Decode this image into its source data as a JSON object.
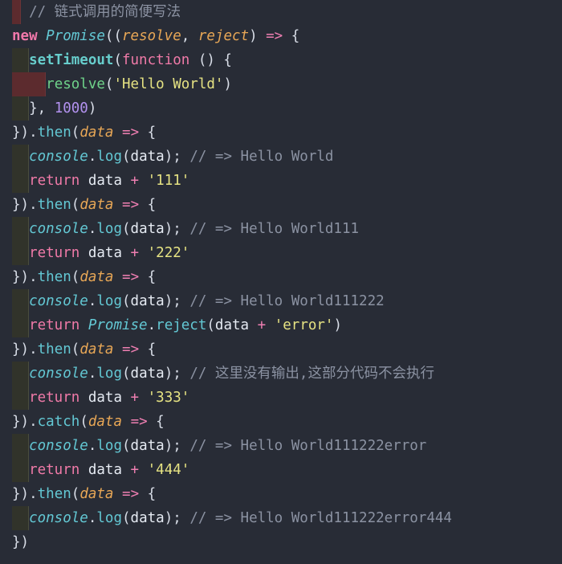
{
  "editor": {
    "language": "javascript",
    "theme_background": "#282c36",
    "font_size_px": 17.5,
    "line_height_px": 30,
    "total_lines": 23,
    "colors": {
      "background": "#282c36",
      "keyword": "#f07aa8",
      "class": "#63c8d4",
      "function": "#67cdcc",
      "parameter": "#e8a756",
      "string": "#e6e383",
      "number": "#b392f0",
      "comment": "#8b92a2",
      "punctuation": "#d9dee8",
      "indent_guide": "#31332a",
      "error_whitespace": "#5c2b2e"
    }
  },
  "code": {
    "lines": [
      {
        "n": 1,
        "indent_guides": 0,
        "error_block": {
          "start": 0,
          "cols": 1
        },
        "tokens": [
          {
            "t": "  ",
            "c": "punc"
          },
          {
            "t": "// 链式调用的简便写法",
            "c": "cmt"
          }
        ]
      },
      {
        "n": 2,
        "indent_guides": 0,
        "tokens": [
          {
            "t": "new",
            "c": "kw-b"
          },
          {
            "t": " ",
            "c": "punc"
          },
          {
            "t": "Promise",
            "c": "cls"
          },
          {
            "t": "((",
            "c": "punc"
          },
          {
            "t": "resolve",
            "c": "param"
          },
          {
            "t": ", ",
            "c": "punc"
          },
          {
            "t": "reject",
            "c": "param"
          },
          {
            "t": ") ",
            "c": "punc"
          },
          {
            "t": "=>",
            "c": "arrow"
          },
          {
            "t": " {",
            "c": "punc"
          }
        ]
      },
      {
        "n": 3,
        "indent_guides": 1,
        "tokens": [
          {
            "t": "  ",
            "c": "punc"
          },
          {
            "t": "setTimeout",
            "c": "fn"
          },
          {
            "t": "(",
            "c": "punc"
          },
          {
            "t": "function",
            "c": "kw"
          },
          {
            "t": " () {",
            "c": "punc"
          }
        ]
      },
      {
        "n": 4,
        "indent_guides": 0,
        "error_block": {
          "start": 0,
          "cols": 4
        },
        "tokens": [
          {
            "t": "    ",
            "c": "punc"
          },
          {
            "t": "resolve",
            "c": "call"
          },
          {
            "t": "(",
            "c": "punc"
          },
          {
            "t": "'Hello World'",
            "c": "str"
          },
          {
            "t": ")",
            "c": "punc"
          }
        ]
      },
      {
        "n": 5,
        "indent_guides": 1,
        "tokens": [
          {
            "t": "  }, ",
            "c": "punc"
          },
          {
            "t": "1000",
            "c": "num"
          },
          {
            "t": ")",
            "c": "punc"
          }
        ]
      },
      {
        "n": 6,
        "indent_guides": 0,
        "tokens": [
          {
            "t": "})",
            "c": "punc"
          },
          {
            "t": ".",
            "c": "punc"
          },
          {
            "t": "then",
            "c": "meth"
          },
          {
            "t": "(",
            "c": "punc"
          },
          {
            "t": "data",
            "c": "param"
          },
          {
            "t": " ",
            "c": "punc"
          },
          {
            "t": "=>",
            "c": "arrow"
          },
          {
            "t": " {",
            "c": "punc"
          }
        ]
      },
      {
        "n": 7,
        "indent_guides": 1,
        "tokens": [
          {
            "t": "  ",
            "c": "punc"
          },
          {
            "t": "console",
            "c": "cls"
          },
          {
            "t": ".",
            "c": "punc"
          },
          {
            "t": "log",
            "c": "meth"
          },
          {
            "t": "(",
            "c": "punc"
          },
          {
            "t": "data",
            "c": "ident"
          },
          {
            "t": "); ",
            "c": "punc"
          },
          {
            "t": "// => Hello World",
            "c": "cmt"
          }
        ]
      },
      {
        "n": 8,
        "indent_guides": 1,
        "tokens": [
          {
            "t": "  ",
            "c": "punc"
          },
          {
            "t": "return",
            "c": "kw"
          },
          {
            "t": " ",
            "c": "punc"
          },
          {
            "t": "data",
            "c": "ident"
          },
          {
            "t": " ",
            "c": "punc"
          },
          {
            "t": "+",
            "c": "op"
          },
          {
            "t": " ",
            "c": "punc"
          },
          {
            "t": "'111'",
            "c": "str"
          }
        ]
      },
      {
        "n": 9,
        "indent_guides": 0,
        "tokens": [
          {
            "t": "})",
            "c": "punc"
          },
          {
            "t": ".",
            "c": "punc"
          },
          {
            "t": "then",
            "c": "meth"
          },
          {
            "t": "(",
            "c": "punc"
          },
          {
            "t": "data",
            "c": "param"
          },
          {
            "t": " ",
            "c": "punc"
          },
          {
            "t": "=>",
            "c": "arrow"
          },
          {
            "t": " {",
            "c": "punc"
          }
        ]
      },
      {
        "n": 10,
        "indent_guides": 1,
        "tokens": [
          {
            "t": "  ",
            "c": "punc"
          },
          {
            "t": "console",
            "c": "cls"
          },
          {
            "t": ".",
            "c": "punc"
          },
          {
            "t": "log",
            "c": "meth"
          },
          {
            "t": "(",
            "c": "punc"
          },
          {
            "t": "data",
            "c": "ident"
          },
          {
            "t": "); ",
            "c": "punc"
          },
          {
            "t": "// => Hello World111",
            "c": "cmt"
          }
        ]
      },
      {
        "n": 11,
        "indent_guides": 1,
        "tokens": [
          {
            "t": "  ",
            "c": "punc"
          },
          {
            "t": "return",
            "c": "kw"
          },
          {
            "t": " ",
            "c": "punc"
          },
          {
            "t": "data",
            "c": "ident"
          },
          {
            "t": " ",
            "c": "punc"
          },
          {
            "t": "+",
            "c": "op"
          },
          {
            "t": " ",
            "c": "punc"
          },
          {
            "t": "'222'",
            "c": "str"
          }
        ]
      },
      {
        "n": 12,
        "indent_guides": 0,
        "tokens": [
          {
            "t": "})",
            "c": "punc"
          },
          {
            "t": ".",
            "c": "punc"
          },
          {
            "t": "then",
            "c": "meth"
          },
          {
            "t": "(",
            "c": "punc"
          },
          {
            "t": "data",
            "c": "param"
          },
          {
            "t": " ",
            "c": "punc"
          },
          {
            "t": "=>",
            "c": "arrow"
          },
          {
            "t": " {",
            "c": "punc"
          }
        ]
      },
      {
        "n": 13,
        "indent_guides": 1,
        "tokens": [
          {
            "t": "  ",
            "c": "punc"
          },
          {
            "t": "console",
            "c": "cls"
          },
          {
            "t": ".",
            "c": "punc"
          },
          {
            "t": "log",
            "c": "meth"
          },
          {
            "t": "(",
            "c": "punc"
          },
          {
            "t": "data",
            "c": "ident"
          },
          {
            "t": "); ",
            "c": "punc"
          },
          {
            "t": "// => Hello World111222",
            "c": "cmt"
          }
        ]
      },
      {
        "n": 14,
        "indent_guides": 1,
        "tokens": [
          {
            "t": "  ",
            "c": "punc"
          },
          {
            "t": "return",
            "c": "kw"
          },
          {
            "t": " ",
            "c": "punc"
          },
          {
            "t": "Promise",
            "c": "cls"
          },
          {
            "t": ".",
            "c": "punc"
          },
          {
            "t": "reject",
            "c": "meth"
          },
          {
            "t": "(",
            "c": "punc"
          },
          {
            "t": "data",
            "c": "ident"
          },
          {
            "t": " ",
            "c": "punc"
          },
          {
            "t": "+",
            "c": "op"
          },
          {
            "t": " ",
            "c": "punc"
          },
          {
            "t": "'error'",
            "c": "str"
          },
          {
            "t": ")",
            "c": "punc"
          }
        ]
      },
      {
        "n": 15,
        "indent_guides": 0,
        "tokens": [
          {
            "t": "})",
            "c": "punc"
          },
          {
            "t": ".",
            "c": "punc"
          },
          {
            "t": "then",
            "c": "meth"
          },
          {
            "t": "(",
            "c": "punc"
          },
          {
            "t": "data",
            "c": "param"
          },
          {
            "t": " ",
            "c": "punc"
          },
          {
            "t": "=>",
            "c": "arrow"
          },
          {
            "t": " {",
            "c": "punc"
          }
        ]
      },
      {
        "n": 16,
        "indent_guides": 1,
        "tokens": [
          {
            "t": "  ",
            "c": "punc"
          },
          {
            "t": "console",
            "c": "cls"
          },
          {
            "t": ".",
            "c": "punc"
          },
          {
            "t": "log",
            "c": "meth"
          },
          {
            "t": "(",
            "c": "punc"
          },
          {
            "t": "data",
            "c": "ident"
          },
          {
            "t": "); ",
            "c": "punc"
          },
          {
            "t": "// 这里没有输出,这部分代码不会执行",
            "c": "cmt"
          }
        ]
      },
      {
        "n": 17,
        "indent_guides": 1,
        "tokens": [
          {
            "t": "  ",
            "c": "punc"
          },
          {
            "t": "return",
            "c": "kw"
          },
          {
            "t": " ",
            "c": "punc"
          },
          {
            "t": "data",
            "c": "ident"
          },
          {
            "t": " ",
            "c": "punc"
          },
          {
            "t": "+",
            "c": "op"
          },
          {
            "t": " ",
            "c": "punc"
          },
          {
            "t": "'333'",
            "c": "str"
          }
        ]
      },
      {
        "n": 18,
        "indent_guides": 0,
        "tokens": [
          {
            "t": "})",
            "c": "punc"
          },
          {
            "t": ".",
            "c": "punc"
          },
          {
            "t": "catch",
            "c": "meth"
          },
          {
            "t": "(",
            "c": "punc"
          },
          {
            "t": "data",
            "c": "param"
          },
          {
            "t": " ",
            "c": "punc"
          },
          {
            "t": "=>",
            "c": "arrow"
          },
          {
            "t": " {",
            "c": "punc"
          }
        ]
      },
      {
        "n": 19,
        "indent_guides": 1,
        "tokens": [
          {
            "t": "  ",
            "c": "punc"
          },
          {
            "t": "console",
            "c": "cls"
          },
          {
            "t": ".",
            "c": "punc"
          },
          {
            "t": "log",
            "c": "meth"
          },
          {
            "t": "(",
            "c": "punc"
          },
          {
            "t": "data",
            "c": "ident"
          },
          {
            "t": "); ",
            "c": "punc"
          },
          {
            "t": "// => Hello World111222error",
            "c": "cmt"
          }
        ]
      },
      {
        "n": 20,
        "indent_guides": 1,
        "tokens": [
          {
            "t": "  ",
            "c": "punc"
          },
          {
            "t": "return",
            "c": "kw"
          },
          {
            "t": " ",
            "c": "punc"
          },
          {
            "t": "data",
            "c": "ident"
          },
          {
            "t": " ",
            "c": "punc"
          },
          {
            "t": "+",
            "c": "op"
          },
          {
            "t": " ",
            "c": "punc"
          },
          {
            "t": "'444'",
            "c": "str"
          }
        ]
      },
      {
        "n": 21,
        "indent_guides": 0,
        "tokens": [
          {
            "t": "})",
            "c": "punc"
          },
          {
            "t": ".",
            "c": "punc"
          },
          {
            "t": "then",
            "c": "meth"
          },
          {
            "t": "(",
            "c": "punc"
          },
          {
            "t": "data",
            "c": "param"
          },
          {
            "t": " ",
            "c": "punc"
          },
          {
            "t": "=>",
            "c": "arrow"
          },
          {
            "t": " {",
            "c": "punc"
          }
        ]
      },
      {
        "n": 22,
        "indent_guides": 1,
        "tokens": [
          {
            "t": "  ",
            "c": "punc"
          },
          {
            "t": "console",
            "c": "cls"
          },
          {
            "t": ".",
            "c": "punc"
          },
          {
            "t": "log",
            "c": "meth"
          },
          {
            "t": "(",
            "c": "punc"
          },
          {
            "t": "data",
            "c": "ident"
          },
          {
            "t": "); ",
            "c": "punc"
          },
          {
            "t": "// => Hello World111222error444",
            "c": "cmt"
          }
        ]
      },
      {
        "n": 23,
        "indent_guides": 0,
        "tokens": [
          {
            "t": "})",
            "c": "punc"
          }
        ]
      }
    ]
  }
}
